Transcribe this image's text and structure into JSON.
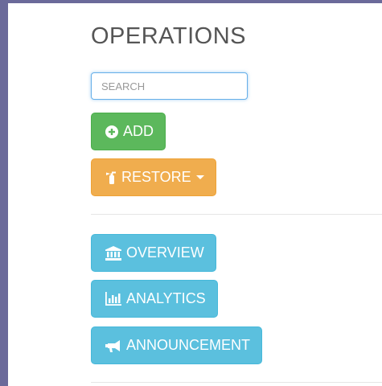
{
  "page": {
    "title": "OPERATIONS"
  },
  "search": {
    "placeholder": "SEARCH",
    "value": ""
  },
  "actions": {
    "add_label": "ADD",
    "restore_label": "RESTORE"
  },
  "navigation": {
    "overview_label": "OVERVIEW",
    "analytics_label": "ANALYTICS",
    "announcement_label": "ANNOUNCEMENT"
  },
  "icons": {
    "add": "plus-circle-icon",
    "restore": "fire-extinguisher-icon",
    "overview": "bank-icon",
    "analytics": "bar-chart-icon",
    "announcement": "megaphone-icon"
  },
  "colors": {
    "background": "#6b6a9a",
    "success": "#5cb85c",
    "warning": "#f0ad4e",
    "info": "#5bc0de",
    "search_focus": "#66afe9"
  }
}
